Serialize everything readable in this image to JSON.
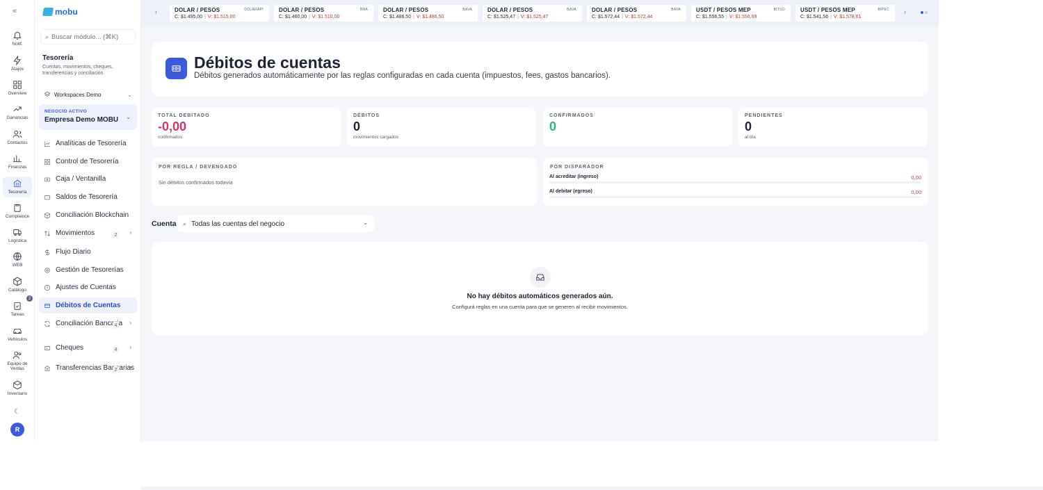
{
  "rail": {
    "items": [
      {
        "label": "Notif.",
        "icon": "bell-icon"
      },
      {
        "label": "Atajos",
        "icon": "bolt-icon"
      },
      {
        "label": "Overview",
        "icon": "grid-icon"
      },
      {
        "label": "Ganancias",
        "icon": "trend-up-icon"
      },
      {
        "label": "Contactos",
        "icon": "users-icon"
      },
      {
        "label": "Finanzas",
        "icon": "bar-chart-icon"
      },
      {
        "label": "Tesorería",
        "icon": "bank-icon"
      },
      {
        "label": "Compliance",
        "icon": "clipboard-icon"
      },
      {
        "label": "Logística",
        "icon": "box-icon"
      },
      {
        "label": "WEB",
        "icon": "globe-icon"
      },
      {
        "label": "Catálogo",
        "icon": "cube-icon"
      },
      {
        "label": "Tareas",
        "icon": "clipboard-check-icon"
      },
      {
        "label": "Vehículos",
        "icon": "car-icon"
      },
      {
        "label": "Equipo de Ventas",
        "icon": "team-icon"
      },
      {
        "label": "Inventario",
        "icon": "package-icon"
      }
    ],
    "catalog_badge": "2",
    "avatar_initial": "R"
  },
  "menu": {
    "logo": "mobu",
    "search_placeholder": "Buscar módulo... (⌘K)",
    "section_title": "Tesorería",
    "section_desc": "Cuentas, movimientos, cheques, transferencias y conciliación.",
    "workspace": "Workspaces Demo",
    "business_tag": "NEGOCIO ACTIVO",
    "business_name": "Empresa Demo MOBU",
    "items": [
      {
        "label": "Analíticas de Tesorería"
      },
      {
        "label": "Control de Tesorería"
      },
      {
        "label": "Caja / Ventanilla"
      },
      {
        "label": "Saldos de Tesorería"
      },
      {
        "label": "Conciliación Blockchain"
      },
      {
        "label": "Movimientos",
        "count": "2"
      },
      {
        "label": "Flujo Diario"
      },
      {
        "label": "Gestión de Tesorerías"
      },
      {
        "label": "Ajustes de Cuentas"
      },
      {
        "label": "Débitos de Cuentas"
      },
      {
        "label": "Conciliación Bancaria",
        "count": "4"
      },
      {
        "label": "Cheques",
        "count": "4"
      },
      {
        "label": "Transferencias Bancarias",
        "count": "2"
      }
    ]
  },
  "ticker": [
    {
      "pair": "DOLAR / PESOS",
      "src": "DOLARAPI",
      "c": "C: $1.495,00",
      "v": "V: $1.515,00"
    },
    {
      "pair": "DOLAR / PESOS",
      "src": "BNA",
      "c": "C: $1.460,00",
      "v": "V: $1.510,00"
    },
    {
      "pair": "DOLAR / PESOS",
      "src": "BAVA",
      "c": "C: $1.486,50",
      "v": "V: $1.486,50"
    },
    {
      "pair": "DOLAR / PESOS",
      "src": "BAVA",
      "c": "C: $1.525,47",
      "v": "V: $1.525,47"
    },
    {
      "pair": "DOLAR / PESOS",
      "src": "BAVA",
      "c": "C: $1.572,44",
      "v": "V: $1.572,44"
    },
    {
      "pair": "USDT / PESOS MEP",
      "src": "BITSO",
      "c": "C: $1.556,55",
      "v": "V: $1.556,69"
    },
    {
      "pair": "USDT / PESOS MEP",
      "src": "BIPEC",
      "c": "C: $1.541,56",
      "v": "V: $1.578,61"
    }
  ],
  "hero": {
    "title": "Débitos de cuentas",
    "subtitle": "Débitos generados automáticamente por las reglas configuradas en cada cuenta (impuestos, fees, gastos bancarios)."
  },
  "kpis": [
    {
      "title": "TOTAL DEBITADO",
      "value": "-0,00",
      "note": "confirmados"
    },
    {
      "title": "DÉBITOS",
      "value": "0",
      "note": "movimientos cargados"
    },
    {
      "title": "CONFIRMADOS",
      "value": "0",
      "note": ""
    },
    {
      "title": "PENDIENTES",
      "value": "0",
      "note": "al día"
    }
  ],
  "by_rule": {
    "title": "POR REGLA / DEVENGADO",
    "empty": "Sin débitos confirmados todavía"
  },
  "by_trigger": {
    "title": "POR DISPARADOR",
    "rows": [
      {
        "label": "Al acreditar (ingreso)",
        "value": "0,00"
      },
      {
        "label": "Al debitar (egreso)",
        "value": "0,00"
      }
    ]
  },
  "account": {
    "label": "Cuenta",
    "value": "Todas las cuentas del negocio"
  },
  "empty_state": {
    "title": "No hay débitos automáticos generados aún.",
    "text": "Configurá reglas en una cuenta para que se generen al recibir movimientos."
  },
  "colors": {
    "accent": "#3b5bdb",
    "negative": "#d6336c",
    "positive": "#2fb380"
  }
}
